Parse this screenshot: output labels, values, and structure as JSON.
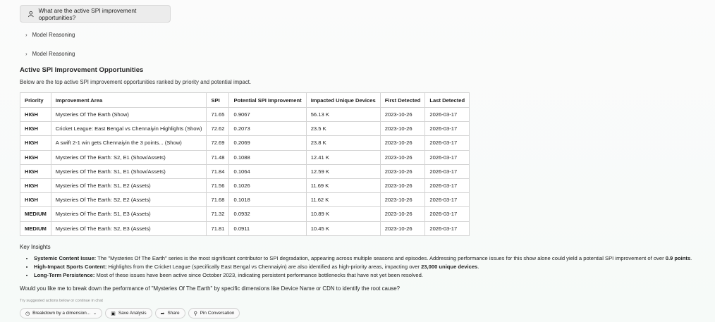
{
  "user_message": "What are the active SPI improvement opportunities?",
  "reasoning_sections": [
    "Model Reasoning",
    "Model Reasoning"
  ],
  "section_title": "Active SPI Improvement Opportunities",
  "section_desc": "Below are the top active SPI improvement opportunities ranked by priority and potential impact.",
  "table": {
    "headers": [
      "Priority",
      "Improvement Area",
      "SPI",
      "Potential SPI Improvement",
      "Impacted Unique Devices",
      "First Detected",
      "Last Detected"
    ],
    "rows": [
      [
        "HIGH",
        "Mysteries Of The Earth (Show)",
        "71.65",
        "0.9067",
        "56.13 K",
        "2023-10-26",
        "2026-03-17"
      ],
      [
        "HIGH",
        "Cricket League: East Bengal vs Chennaiyin Highlights (Show)",
        "72.62",
        "0.2073",
        "23.5 K",
        "2023-10-26",
        "2026-03-17"
      ],
      [
        "HIGH",
        "A swift 2-1 win gets Chennaiyin the 3 points... (Show)",
        "72.69",
        "0.2069",
        "23.8 K",
        "2023-10-26",
        "2026-03-17"
      ],
      [
        "HIGH",
        "Mysteries Of The Earth: S2, E1 (Show/Assets)",
        "71.48",
        "0.1088",
        "12.41 K",
        "2023-10-26",
        "2026-03-17"
      ],
      [
        "HIGH",
        "Mysteries Of The Earth: S1, E1 (Show/Assets)",
        "71.84",
        "0.1064",
        "12.59 K",
        "2023-10-26",
        "2026-03-17"
      ],
      [
        "HIGH",
        "Mysteries Of The Earth: S1, E2 (Assets)",
        "71.56",
        "0.1026",
        "11.69 K",
        "2023-10-26",
        "2026-03-17"
      ],
      [
        "HIGH",
        "Mysteries Of The Earth: S2, E2 (Assets)",
        "71.68",
        "0.1018",
        "11.62 K",
        "2023-10-26",
        "2026-03-17"
      ],
      [
        "MEDIUM",
        "Mysteries Of The Earth: S1, E3 (Assets)",
        "71.32",
        "0.0932",
        "10.89 K",
        "2023-10-26",
        "2026-03-17"
      ],
      [
        "MEDIUM",
        "Mysteries Of The Earth: S2, E3 (Assets)",
        "71.81",
        "0.0911",
        "10.45 K",
        "2023-10-26",
        "2026-03-17"
      ]
    ]
  },
  "key_insights_title": "Key Insights",
  "insights": [
    {
      "label": "Systemic Content Issue:",
      "text": " The \"Mysteries Of The Earth\" series is the most significant contributor to SPI degradation, appearing across multiple seasons and episodes. Addressing performance issues for this show alone could yield a potential SPI improvement of over ",
      "bold": "0.9 points",
      "tail": "."
    },
    {
      "label": "High-Impact Sports Content:",
      "text": " Highlights from the Cricket League (specifically East Bengal vs Chennaiyin) are also identified as high-priority areas, impacting over ",
      "bold": "23,000 unique devices",
      "tail": "."
    },
    {
      "label": "Long-Term Persistence:",
      "text": " Most of these issues have been active since October 2023, indicating persistent performance bottlenecks that have not yet been resolved.",
      "bold": "",
      "tail": ""
    }
  ],
  "followup_question": "Would you like me to break down the performance of \"Mysteries Of The Earth\" by specific dimensions like Device Name or CDN to identify the root cause?",
  "hint": "Try suggested actions below or continue in chat",
  "actions": {
    "breakdown": "Breakdown by a dimension...",
    "save": "Save Analysis",
    "share": "Share",
    "pin": "Pin Conversation"
  }
}
